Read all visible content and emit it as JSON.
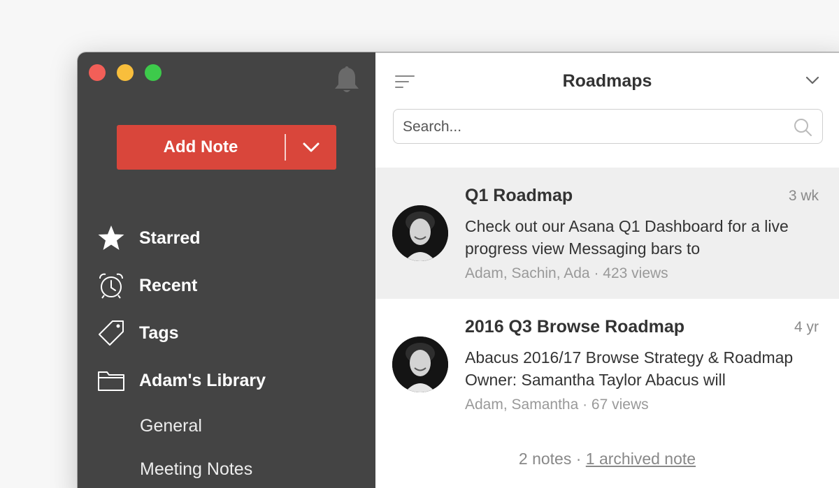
{
  "sidebar": {
    "add_note_label": "Add Note",
    "nav": [
      {
        "label": "Starred",
        "icon": "star-icon"
      },
      {
        "label": "Recent",
        "icon": "alarm-clock-icon"
      },
      {
        "label": "Tags",
        "icon": "tag-icon"
      },
      {
        "label": "Adam's Library",
        "icon": "folder-icon"
      }
    ],
    "sub_items": [
      "General",
      "Meeting Notes"
    ]
  },
  "main": {
    "title": "Roadmaps",
    "search_placeholder": "Search...",
    "notes": [
      {
        "title": "Q1 Roadmap",
        "age": "3 wk",
        "snippet": "Check out our Asana Q1 Dashboard for a live progress view Messaging bars to",
        "meta": "Adam, Sachin, Ada · 423 views"
      },
      {
        "title": "2016 Q3 Browse Roadmap",
        "age": "4 yr",
        "snippet": "Abacus 2016/17 Browse Strategy & Roadmap Owner: Samantha Taylor Abacus will",
        "meta": "Adam, Samantha · 67 views"
      }
    ],
    "footer_count": "2 notes · ",
    "footer_link": "1 archived note"
  },
  "colors": {
    "sidebar_bg": "#444444",
    "accent": "#d9463b",
    "selected_row": "#efefef"
  }
}
